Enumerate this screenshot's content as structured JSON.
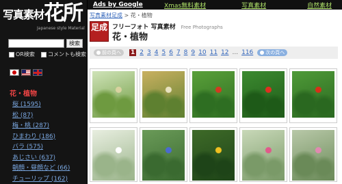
{
  "sidebar": {
    "logo_text": "写真素材",
    "logo_kanji": "花所",
    "logo_subtitle": "Japanese style Material",
    "search_placeholder": "",
    "search_button": "検索",
    "option_or": "OR検索",
    "option_comment": "コメントも検索",
    "category_title": "花・植物",
    "categories": [
      "桜 (1595)",
      "松 (87)",
      "梅・桃 (287)",
      "ひまわり (186)",
      "バラ (575)",
      "あじさい (637)",
      "朝顔・昼顔など (66)",
      "チューリップ (162)"
    ]
  },
  "adbar": {
    "ads_label": "Ads by Google",
    "links": [
      "Xmas無料素材",
      "写真素材",
      "自然素材"
    ]
  },
  "breadcrumb": {
    "link": "写真素材足成",
    "separator": " > ",
    "current": "花・植物"
  },
  "header": {
    "stamp_text": "足成",
    "site_title": "フリーフォト 写真素材",
    "site_title_en": "Free Photographs",
    "page_title": "花・植物"
  },
  "pager": {
    "prev": "前の頁へ",
    "pages": [
      "1",
      "2",
      "3",
      "4",
      "5",
      "6",
      "7",
      "8",
      "9",
      "10",
      "11",
      "12",
      "...",
      "116"
    ],
    "current": "1",
    "next": "次の頁へ"
  },
  "photos": [
    {
      "name": "photo-leaves",
      "colors": [
        "#cfe3b8",
        "#6e9a40",
        "#d9d2a0"
      ]
    },
    {
      "name": "photo-yellow-bokeh",
      "colors": [
        "#c9b060",
        "#5e8030",
        "#e8e2c0"
      ]
    },
    {
      "name": "photo-red-flower-green",
      "colors": [
        "#5aa03a",
        "#2e6e22",
        "#d23a20"
      ]
    },
    {
      "name": "photo-red-flower-bush",
      "colors": [
        "#3c8a30",
        "#1e5a18",
        "#e03020"
      ]
    },
    {
      "name": "photo-red-flower-leaves",
      "colors": [
        "#4f9a38",
        "#2a6820",
        "#d83018"
      ]
    },
    {
      "name": "photo-white-flowers",
      "colors": [
        "#e8eee0",
        "#9ab48a",
        "#ffffff"
      ]
    },
    {
      "name": "photo-blue-flowers",
      "colors": [
        "#6a9a58",
        "#3a6a30",
        "#4a6ad0"
      ]
    },
    {
      "name": "photo-yellow-flowers",
      "colors": [
        "#3e6a28",
        "#1e4418",
        "#f0c020"
      ]
    },
    {
      "name": "photo-pink-rose",
      "colors": [
        "#c8d8b8",
        "#7a9a68",
        "#e05a8a"
      ]
    },
    {
      "name": "photo-pink-flower",
      "colors": [
        "#b8c8a8",
        "#6a8a58",
        "#e08ab0"
      ]
    }
  ]
}
